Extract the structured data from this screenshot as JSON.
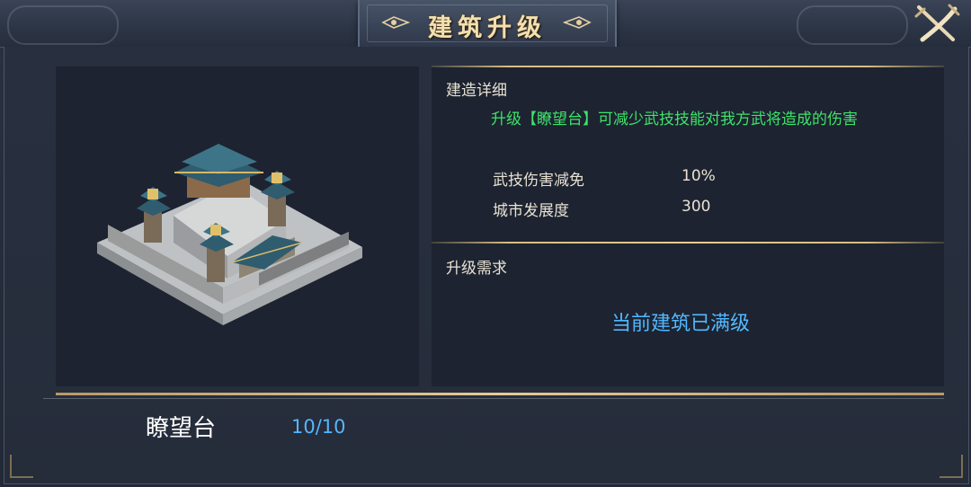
{
  "window": {
    "title": "建筑升级",
    "close_icon": "close-swords-icon"
  },
  "building": {
    "name": "瞭望台",
    "level": "10/10",
    "image": "watchtower-building-icon"
  },
  "details": {
    "section_title": "建造详细",
    "description": "升级【瞭望台】可减少武技技能对我方武将造成的伤害",
    "stats": [
      {
        "label": "武技伤害减免",
        "value": "10%"
      },
      {
        "label": "城市发展度",
        "value": "300"
      }
    ]
  },
  "requirements": {
    "section_title": "升级需求",
    "status": "当前建筑已满级"
  },
  "colors": {
    "description": "#3ee36b",
    "status": "#52b8ff",
    "level": "#55b6ff",
    "title": "#f3e0b0",
    "gold_line": "#e6cb92"
  }
}
